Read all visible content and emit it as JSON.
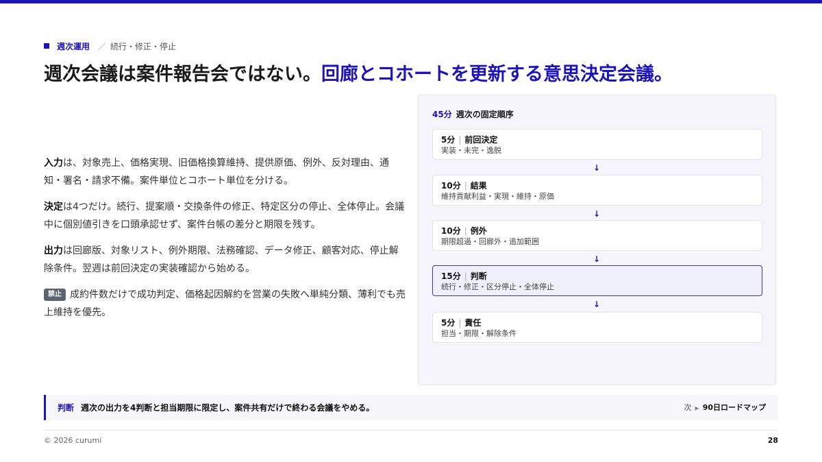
{
  "header": {
    "section": "週次運用",
    "separator": "／",
    "sub": "続行・修正・停止",
    "title_main": "週次会議は案件報告会ではない。",
    "title_highlight": "回廊とコホートを更新する意思決定会議。",
    "accent_color": "#1c14b8"
  },
  "body": {
    "input_label": "入力",
    "input_text": "は、対象売上、価格実現、旧価格換算維持、提供原価、例外、反対理由、通知・署名・請求不備。案件単位とコホート単位を分ける。",
    "decision_label": "決定",
    "decision_text": "は4つだけ。続行、提案順・交換条件の修正、特定区分の停止、全体停止。会議中に個別値引きを口頭承認せず、案件台帳の差分と期限を残す。",
    "output_label": "出力",
    "output_text": "は回廊版、対象リスト、例外期限、法務確認、データ修正、顧客対応、停止解除条件。翌週は前回決定の実装確認から始める。",
    "ban_tag": "禁止",
    "ban_text": "成約件数だけで成功判定、価格起因解約を営業の失敗へ単純分類、薄利でも売上維持を優先。"
  },
  "panel": {
    "minutes": "45分",
    "title": "週次の固定順序",
    "steps": [
      {
        "time": "5分",
        "name": "前回決定",
        "detail": "実装・未完・逸脱",
        "active": false
      },
      {
        "time": "10分",
        "name": "結果",
        "detail": "維持貢献利益・実現・維持・原価",
        "active": false
      },
      {
        "time": "10分",
        "name": "例外",
        "detail": "期限超過・回廊外・追加範囲",
        "active": false
      },
      {
        "time": "15分",
        "name": "判断",
        "detail": "続行・修正・区分停止・全体停止",
        "active": true
      },
      {
        "time": "5分",
        "name": "責任",
        "detail": "担当・期限・解除条件",
        "active": false
      }
    ],
    "arrow_glyph": "↓"
  },
  "judgement": {
    "label": "判断",
    "text": "週次の出力を4判断と担当期限に限定し、案件共有だけで終わる会議をやめる。",
    "next_label": "次",
    "next_title": "90日ロードマップ"
  },
  "footer": {
    "copyright": "© 2026 curumi",
    "page": "28"
  }
}
